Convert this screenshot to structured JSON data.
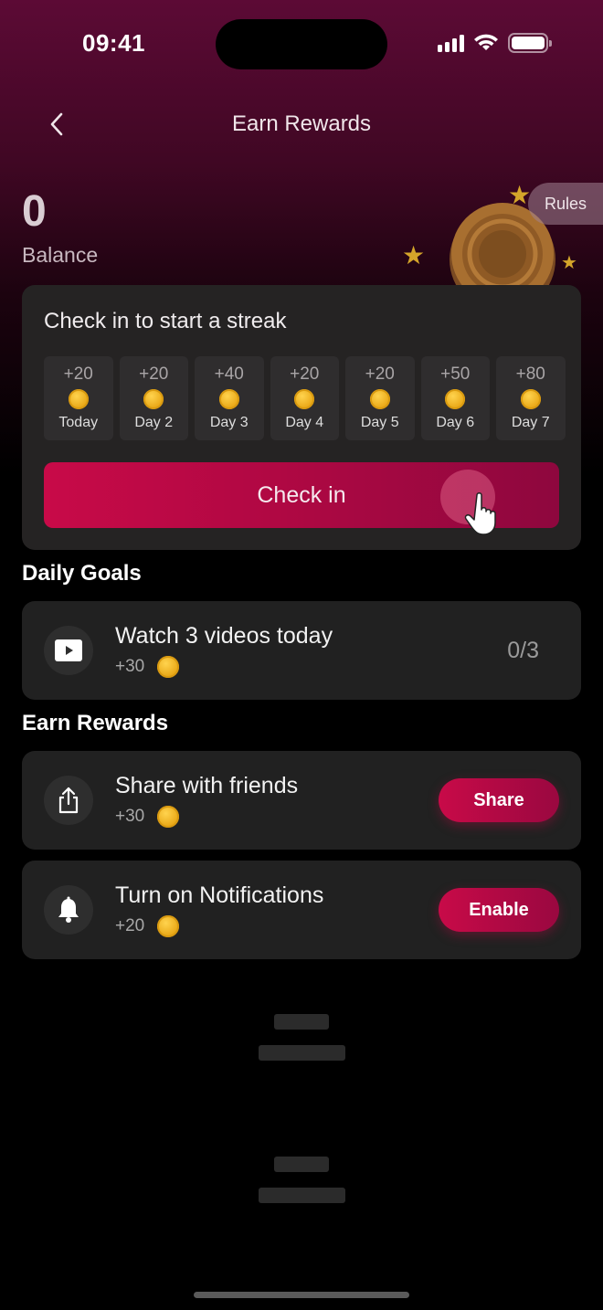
{
  "status": {
    "time": "09:41"
  },
  "nav": {
    "title": "Earn Rewards"
  },
  "balance": {
    "value": "0",
    "label": "Balance"
  },
  "rules": {
    "label": "Rules"
  },
  "streak": {
    "title": "Check in to start a streak",
    "days": [
      {
        "points": "+20",
        "label": "Today"
      },
      {
        "points": "+20",
        "label": "Day 2"
      },
      {
        "points": "+40",
        "label": "Day 3"
      },
      {
        "points": "+20",
        "label": "Day 4"
      },
      {
        "points": "+20",
        "label": "Day 5"
      },
      {
        "points": "+50",
        "label": "Day 6"
      },
      {
        "points": "+80",
        "label": "Day 7"
      }
    ],
    "button_label": "Check in"
  },
  "daily_goals": {
    "title": "Daily Goals",
    "items": [
      {
        "title": "Watch 3 videos today",
        "reward": "+30",
        "progress": "0/3",
        "icon": "play-icon"
      }
    ]
  },
  "earn_rewards": {
    "title": "Earn Rewards",
    "items": [
      {
        "title": "Share with friends",
        "reward": "+30",
        "button": "Share",
        "icon": "share-icon"
      },
      {
        "title": "Turn on Notifications",
        "reward": "+20",
        "button": "Enable",
        "icon": "bell-icon"
      }
    ]
  },
  "colors": {
    "accent": "#c80a48",
    "coin": "#e8a614",
    "card": "#212121"
  }
}
